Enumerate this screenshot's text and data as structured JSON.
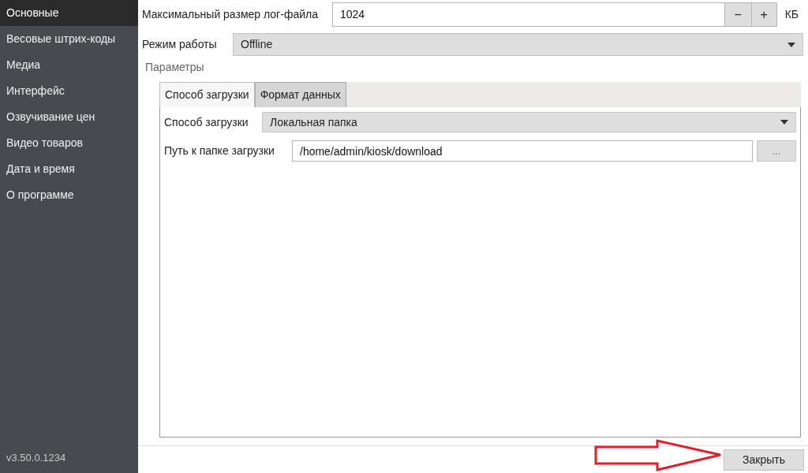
{
  "sidebar": {
    "items": [
      {
        "label": "Основные",
        "selected": true
      },
      {
        "label": "Весовые штрих-коды",
        "selected": false
      },
      {
        "label": "Медиа",
        "selected": false
      },
      {
        "label": "Интерфейс",
        "selected": false
      },
      {
        "label": "Озвучивание цен",
        "selected": false
      },
      {
        "label": "Видео товаров",
        "selected": false
      },
      {
        "label": "Дата и время",
        "selected": false
      },
      {
        "label": "О программе",
        "selected": false
      }
    ],
    "version": "v3.50.0.1234"
  },
  "log_size": {
    "label": "Максимальный размер лог-файла",
    "value": "1024",
    "minus": "−",
    "plus": "+",
    "unit": "КБ"
  },
  "mode": {
    "label": "Режим работы",
    "value": "Offline"
  },
  "parameters": {
    "title": "Параметры",
    "tabs": [
      {
        "label": "Способ загрузки",
        "selected": true
      },
      {
        "label": "Формат данных",
        "selected": false
      }
    ],
    "method": {
      "label": "Способ загрузки",
      "value": "Локальная папка"
    },
    "path": {
      "label": "Путь к папке загрузки",
      "value": "/home/admin/kiosk/download",
      "browse": "..."
    }
  },
  "close_button": "Закрыть"
}
